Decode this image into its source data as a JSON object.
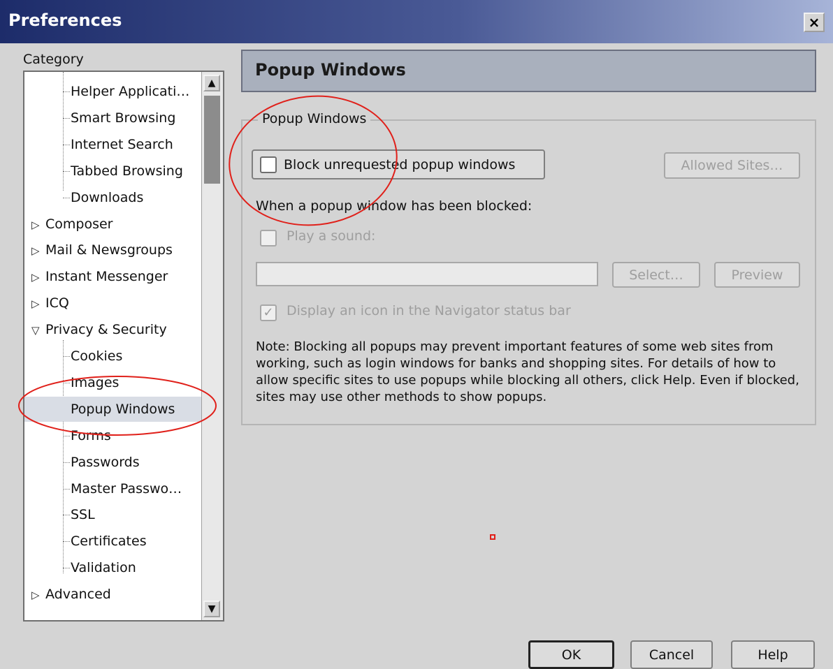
{
  "window": {
    "title": "Preferences",
    "close_label": "×"
  },
  "sidebar": {
    "label": "Category",
    "items": [
      {
        "label": "Helper Applicati…",
        "level": 1,
        "twisty": ""
      },
      {
        "label": "Smart Browsing",
        "level": 1,
        "twisty": ""
      },
      {
        "label": "Internet Search",
        "level": 1,
        "twisty": ""
      },
      {
        "label": "Tabbed Browsing",
        "level": 1,
        "twisty": ""
      },
      {
        "label": "Downloads",
        "level": 1,
        "twisty": ""
      },
      {
        "label": "Composer",
        "level": 0,
        "twisty": "▷"
      },
      {
        "label": "Mail & Newsgroups",
        "level": 0,
        "twisty": "▷"
      },
      {
        "label": "Instant Messenger",
        "level": 0,
        "twisty": "▷"
      },
      {
        "label": "ICQ",
        "level": 0,
        "twisty": "▷"
      },
      {
        "label": "Privacy & Security",
        "level": 0,
        "twisty": "▽"
      },
      {
        "label": "Cookies",
        "level": 1,
        "twisty": ""
      },
      {
        "label": "Images",
        "level": 1,
        "twisty": ""
      },
      {
        "label": "Popup Windows",
        "level": 1,
        "twisty": "",
        "selected": true
      },
      {
        "label": "Forms",
        "level": 1,
        "twisty": ""
      },
      {
        "label": "Passwords",
        "level": 1,
        "twisty": ""
      },
      {
        "label": "Master Passwo…",
        "level": 1,
        "twisty": ""
      },
      {
        "label": "SSL",
        "level": 1,
        "twisty": ""
      },
      {
        "label": "Certificates",
        "level": 1,
        "twisty": ""
      },
      {
        "label": "Validation",
        "level": 1,
        "twisty": ""
      },
      {
        "label": "Advanced",
        "level": 0,
        "twisty": "▷"
      }
    ],
    "scroll_up_icon": "▲",
    "scroll_down_icon": "▼"
  },
  "panel": {
    "header_title": "Popup Windows",
    "group_legend": "Popup Windows",
    "block_checkbox": {
      "label": "Block unrequested popup windows",
      "checked": false
    },
    "allowed_sites_button": "Allowed Sites…",
    "blocked_caption": "When a popup window has been blocked:",
    "play_sound": {
      "label": "Play a sound:",
      "checked": false
    },
    "sound_file_value": "",
    "select_button": "Select…",
    "preview_button": "Preview",
    "status_icon": {
      "label": "Display an icon in the Navigator status bar",
      "checked": true,
      "mark": "✓"
    },
    "note": "Note: Blocking all popups may prevent important features of some web sites from working, such as login windows for banks and shopping sites. For details of how to allow specific sites to use popups while blocking all others, click Help. Even if blocked, sites may use other methods to show popups."
  },
  "footer": {
    "ok": "OK",
    "cancel": "Cancel",
    "help": "Help"
  },
  "colors": {
    "annotation": "#e0201a",
    "titlebar_dark": "#1d2c6a",
    "selection": "#d9dde5"
  }
}
